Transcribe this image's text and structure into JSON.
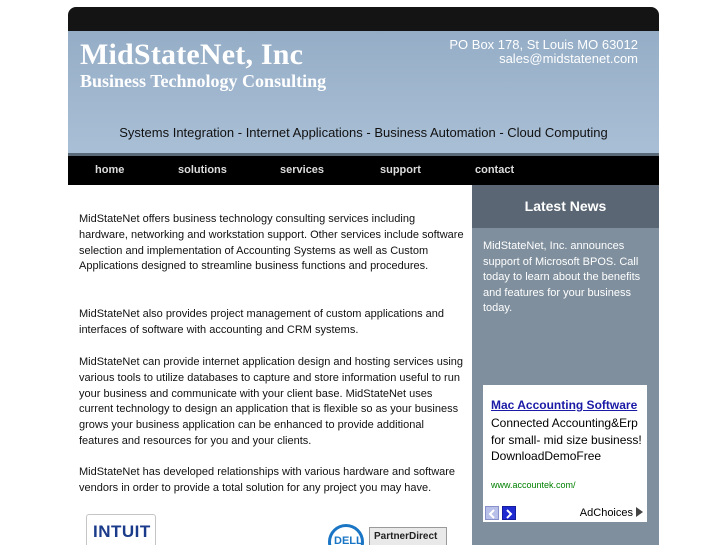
{
  "header": {
    "brand": "MidStateNet, Inc",
    "tagline": "Business Technology Consulting",
    "address": "PO Box 178, St Louis MO 63012",
    "email": "sales@midstatenet.com",
    "services_line": "Systems Integration - Internet Applications - Business Automation - Cloud Computing"
  },
  "nav": {
    "items": [
      {
        "label": "home"
      },
      {
        "label": "solutions"
      },
      {
        "label": "services"
      },
      {
        "label": "support"
      },
      {
        "label": "contact"
      }
    ]
  },
  "main": {
    "paragraphs": [
      "MidStateNet offers business technology consulting services including hardware, networking and workstation support. Other services include software selection and implementation of Accounting Systems as well as Custom Applications designed to streamline business functions and procedures.",
      "MidStateNet also provides project management of custom applications and interfaces of software with accounting and CRM systems.",
      "MidStateNet can provide internet application design and hosting services using various tools to utilize databases to capture and store information useful to run your business and communicate with your client base. MidStateNet uses current technology to design an application that is flexible so as your business grows your business application can be enhanced to provide additional features and resources for you and your clients.",
      "MidStateNet has developed relationships with various hardware and software vendors in order to provide a total solution for any project you may have."
    ]
  },
  "sidebar": {
    "heading": "Latest News",
    "news": "MidStateNet, Inc. announces support of Microsoft BPOS. Call today to learn about the benefits and features for your business today."
  },
  "ad": {
    "title": "Mac Accounting Software",
    "body": "Connected Accounting&Erp for small- mid size business! DownloadDemoFree",
    "url": "www.accountek.com/",
    "choices": "AdChoices"
  },
  "partners": {
    "intuit": "INTUIT",
    "dell": "DELL",
    "dell_program": "PartnerDirect"
  },
  "colors": {
    "banner": "#a1b7cf",
    "nav_bg": "#000000",
    "sidebar_bg": "#7f8f9d",
    "sidebar_head": "#5a6673",
    "ad_link": "#1a1aa6"
  }
}
